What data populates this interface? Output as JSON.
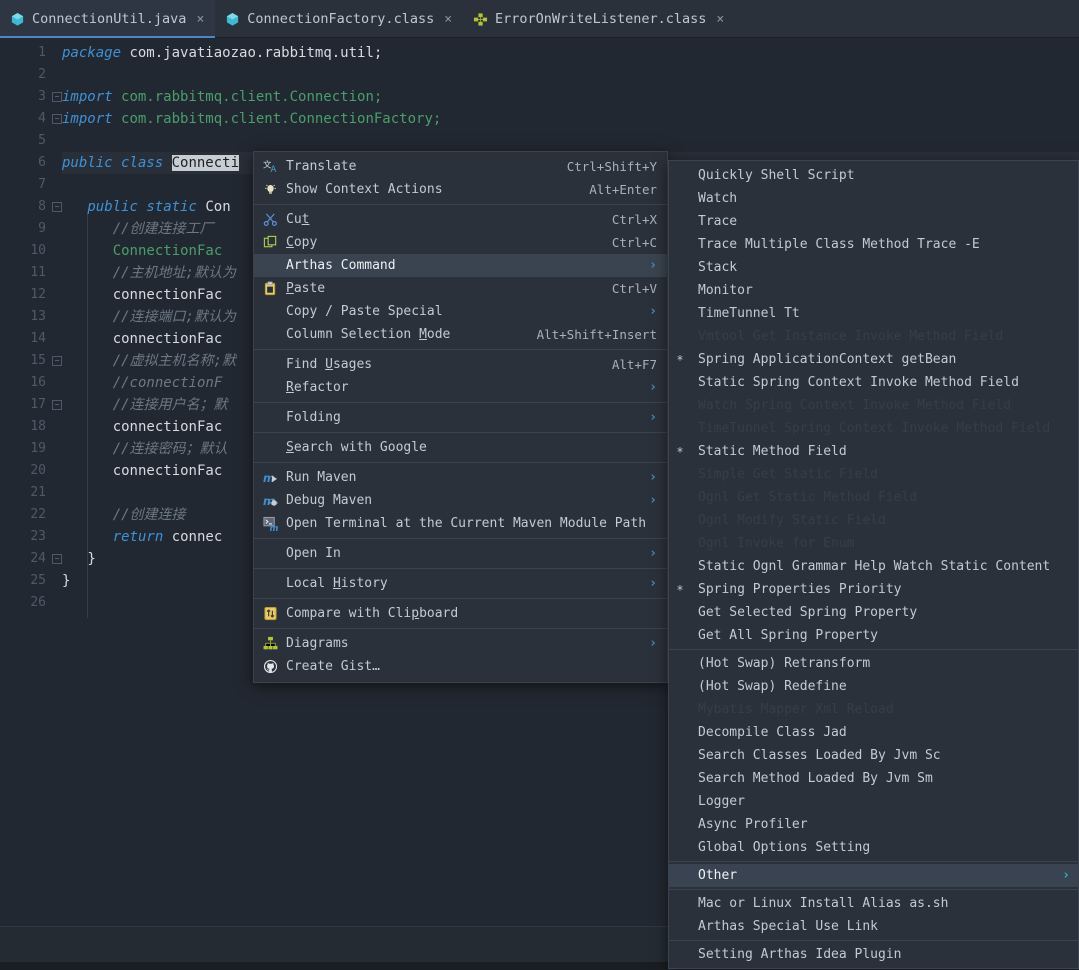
{
  "tabs": [
    {
      "label": "ConnectionUtil.java",
      "icon": "java-class-icon",
      "active": true,
      "close": "×"
    },
    {
      "label": "ConnectionFactory.class",
      "icon": "java-class-icon",
      "active": false,
      "close": "×"
    },
    {
      "label": "ErrorOnWriteListener.class",
      "icon": "java-interface-icon",
      "active": false,
      "close": "×"
    }
  ],
  "editor": {
    "file": "ConnectionUtil.java",
    "selection": "Connecti",
    "gutter": [
      "1",
      "2",
      "3",
      "4",
      "5",
      "6",
      "7",
      "8",
      "9",
      "10",
      "11",
      "12",
      "13",
      "14",
      "15",
      "16",
      "17",
      "18",
      "19",
      "20",
      "21",
      "22",
      "23",
      "24",
      "25",
      "26"
    ],
    "lines": [
      {
        "n": 1,
        "text": "package com.javatiaozao.rabbitmq.util;"
      },
      {
        "n": 2,
        "text": ""
      },
      {
        "n": 3,
        "text": "import com.rabbitmq.client.Connection;"
      },
      {
        "n": 4,
        "text": "import com.rabbitmq.client.ConnectionFactory;"
      },
      {
        "n": 5,
        "text": ""
      },
      {
        "n": 6,
        "text": "public class Connecti"
      },
      {
        "n": 7,
        "text": ""
      },
      {
        "n": 8,
        "text": "public static Con"
      },
      {
        "n": 9,
        "text": "//创建连接工厂"
      },
      {
        "n": 10,
        "text": "ConnectionFac"
      },
      {
        "n": 11,
        "text": "//主机地址;默认为"
      },
      {
        "n": 12,
        "text": "connectionFac"
      },
      {
        "n": 13,
        "text": "//连接端口;默认为"
      },
      {
        "n": 14,
        "text": "connectionFac"
      },
      {
        "n": 15,
        "text": "//虚拟主机名称;默"
      },
      {
        "n": 16,
        "text": "//connectionF"
      },
      {
        "n": 17,
        "text": "//连接用户名；默"
      },
      {
        "n": 18,
        "text": "connectionFac"
      },
      {
        "n": 19,
        "text": "//连接密码；默认"
      },
      {
        "n": 20,
        "text": "connectionFac"
      },
      {
        "n": 21,
        "text": ""
      },
      {
        "n": 22,
        "text": "//创建连接"
      },
      {
        "n": 23,
        "text": "return connec"
      },
      {
        "n": 24,
        "text": "}"
      },
      {
        "n": 25,
        "text": "}"
      },
      {
        "n": 26,
        "text": ""
      }
    ]
  },
  "context_menu": {
    "items": [
      {
        "label": "Translate",
        "shortcut": "Ctrl+Shift+Y",
        "icon": "translate-icon",
        "arrow": false,
        "highlight": false,
        "sep_after": false
      },
      {
        "label": "Show Context Actions",
        "shortcut": "Alt+Enter",
        "icon": "lightbulb-icon",
        "arrow": false,
        "highlight": false,
        "sep_after": true
      },
      {
        "label": "Cut",
        "shortcut": "Ctrl+X",
        "icon": "scissors-icon",
        "arrow": false,
        "highlight": false,
        "sep_after": false,
        "mnemonic": 2
      },
      {
        "label": "Copy",
        "shortcut": "Ctrl+C",
        "icon": "copy-icon",
        "arrow": false,
        "highlight": false,
        "sep_after": false,
        "mnemonic": 0
      },
      {
        "label": "Arthas Command",
        "shortcut": "",
        "icon": "",
        "arrow": true,
        "highlight": true,
        "sep_after": false
      },
      {
        "label": "Paste",
        "shortcut": "Ctrl+V",
        "icon": "paste-icon",
        "arrow": false,
        "highlight": false,
        "sep_after": false,
        "mnemonic": 0
      },
      {
        "label": "Copy / Paste Special",
        "shortcut": "",
        "icon": "",
        "arrow": true,
        "highlight": false,
        "sep_after": false
      },
      {
        "label": "Column Selection Mode",
        "shortcut": "Alt+Shift+Insert",
        "icon": "",
        "arrow": false,
        "highlight": false,
        "sep_after": true,
        "mnemonic": 17
      },
      {
        "label": "Find Usages",
        "shortcut": "Alt+F7",
        "icon": "",
        "arrow": false,
        "highlight": false,
        "sep_after": false,
        "mnemonic": 5
      },
      {
        "label": "Refactor",
        "shortcut": "",
        "icon": "",
        "arrow": true,
        "highlight": false,
        "sep_after": true,
        "mnemonic": 0
      },
      {
        "label": "Folding",
        "shortcut": "",
        "icon": "",
        "arrow": true,
        "highlight": false,
        "sep_after": true
      },
      {
        "label": "Search with Google",
        "shortcut": "",
        "icon": "",
        "arrow": false,
        "highlight": false,
        "sep_after": true,
        "mnemonic": 0
      },
      {
        "label": "Run Maven",
        "shortcut": "",
        "icon": "maven-run-icon",
        "arrow": true,
        "highlight": false,
        "sep_after": false
      },
      {
        "label": "Debug Maven",
        "shortcut": "",
        "icon": "maven-debug-icon",
        "arrow": true,
        "highlight": false,
        "sep_after": false
      },
      {
        "label": "Open Terminal at the Current Maven Module Path",
        "shortcut": "",
        "icon": "terminal-maven-icon",
        "arrow": false,
        "highlight": false,
        "sep_after": true
      },
      {
        "label": "Open In",
        "shortcut": "",
        "icon": "",
        "arrow": true,
        "highlight": false,
        "sep_after": true
      },
      {
        "label": "Local History",
        "shortcut": "",
        "icon": "",
        "arrow": true,
        "highlight": false,
        "sep_after": true,
        "mnemonic": 6
      },
      {
        "label": "Compare with Clipboard",
        "shortcut": "",
        "icon": "compare-icon",
        "arrow": false,
        "highlight": false,
        "sep_after": true,
        "mnemonic": 16
      },
      {
        "label": "Diagrams",
        "shortcut": "",
        "icon": "diagram-icon",
        "arrow": true,
        "highlight": false,
        "sep_after": false
      },
      {
        "label": "Create Gist…",
        "shortcut": "",
        "icon": "github-icon",
        "arrow": false,
        "highlight": false,
        "sep_after": false
      }
    ]
  },
  "submenu": {
    "title": "Arthas Command",
    "items": [
      {
        "label": "Quickly Shell Script",
        "star": false,
        "disabled": false,
        "arrow": false,
        "highlight": false,
        "sep_after": false
      },
      {
        "label": "Watch",
        "star": false,
        "disabled": false,
        "arrow": false,
        "highlight": false,
        "sep_after": false
      },
      {
        "label": "Trace",
        "star": false,
        "disabled": false,
        "arrow": false,
        "highlight": false,
        "sep_after": false
      },
      {
        "label": "Trace Multiple Class Method Trace -E",
        "star": false,
        "disabled": false,
        "arrow": false,
        "highlight": false,
        "sep_after": false
      },
      {
        "label": "Stack",
        "star": false,
        "disabled": false,
        "arrow": false,
        "highlight": false,
        "sep_after": false
      },
      {
        "label": "Monitor",
        "star": false,
        "disabled": false,
        "arrow": false,
        "highlight": false,
        "sep_after": false
      },
      {
        "label": "TimeTunnel Tt",
        "star": false,
        "disabled": false,
        "arrow": false,
        "highlight": false,
        "sep_after": false
      },
      {
        "label": "Vmtool Get Instance Invoke Method Field",
        "star": false,
        "disabled": true,
        "arrow": false,
        "highlight": false,
        "sep_after": false
      },
      {
        "label": "Spring ApplicationContext getBean",
        "star": true,
        "disabled": false,
        "arrow": false,
        "highlight": false,
        "sep_after": false
      },
      {
        "label": "Static Spring Context Invoke  Method Field",
        "star": false,
        "disabled": false,
        "arrow": false,
        "highlight": false,
        "sep_after": false
      },
      {
        "label": "Watch Spring Context Invoke Method Field",
        "star": false,
        "disabled": true,
        "arrow": false,
        "highlight": false,
        "sep_after": false
      },
      {
        "label": "TimeTunnel Spring Context Invoke Method Field",
        "star": false,
        "disabled": true,
        "arrow": false,
        "highlight": false,
        "sep_after": false
      },
      {
        "label": "Static Method Field",
        "star": true,
        "disabled": false,
        "arrow": false,
        "highlight": false,
        "sep_after": false
      },
      {
        "label": "Simple Get Static Field",
        "star": false,
        "disabled": true,
        "arrow": false,
        "highlight": false,
        "sep_after": false
      },
      {
        "label": "Ognl Get Static Method Field",
        "star": false,
        "disabled": true,
        "arrow": false,
        "highlight": false,
        "sep_after": false
      },
      {
        "label": "Ognl Modify Static Field",
        "star": false,
        "disabled": true,
        "arrow": false,
        "highlight": false,
        "sep_after": false
      },
      {
        "label": "Ognl Invoke for Enum",
        "star": false,
        "disabled": true,
        "arrow": false,
        "highlight": false,
        "sep_after": false
      },
      {
        "label": "Static Ognl Grammar Help Watch Static Content",
        "star": false,
        "disabled": false,
        "arrow": false,
        "highlight": false,
        "sep_after": false
      },
      {
        "label": "Spring Properties Priority",
        "star": true,
        "disabled": false,
        "arrow": false,
        "highlight": false,
        "sep_after": false
      },
      {
        "label": "Get Selected Spring Property",
        "star": false,
        "disabled": false,
        "arrow": false,
        "highlight": false,
        "sep_after": false
      },
      {
        "label": "Get All Spring Property",
        "star": false,
        "disabled": false,
        "arrow": false,
        "highlight": false,
        "sep_after": true
      },
      {
        "label": "(Hot Swap) Retransform",
        "star": false,
        "disabled": false,
        "arrow": false,
        "highlight": false,
        "sep_after": false
      },
      {
        "label": "(Hot Swap) Redefine",
        "star": false,
        "disabled": false,
        "arrow": false,
        "highlight": false,
        "sep_after": false
      },
      {
        "label": "Mybatis Mapper Xml Reload",
        "star": false,
        "disabled": true,
        "arrow": false,
        "highlight": false,
        "sep_after": false
      },
      {
        "label": "Decompile Class Jad",
        "star": false,
        "disabled": false,
        "arrow": false,
        "highlight": false,
        "sep_after": false
      },
      {
        "label": "Search Classes Loaded By Jvm Sc",
        "star": false,
        "disabled": false,
        "arrow": false,
        "highlight": false,
        "sep_after": false
      },
      {
        "label": "Search Method Loaded By Jvm Sm",
        "star": false,
        "disabled": false,
        "arrow": false,
        "highlight": false,
        "sep_after": false
      },
      {
        "label": "Logger",
        "star": false,
        "disabled": false,
        "arrow": false,
        "highlight": false,
        "sep_after": false
      },
      {
        "label": "Async Profiler",
        "star": false,
        "disabled": false,
        "arrow": false,
        "highlight": false,
        "sep_after": false
      },
      {
        "label": "Global Options Setting",
        "star": false,
        "disabled": false,
        "arrow": false,
        "highlight": false,
        "sep_after": true
      },
      {
        "label": "Other",
        "star": false,
        "disabled": false,
        "arrow": true,
        "highlight": true,
        "sep_after": true
      },
      {
        "label": "Mac or Linux Install Alias as.sh",
        "star": false,
        "disabled": false,
        "arrow": false,
        "highlight": false,
        "sep_after": false
      },
      {
        "label": "Arthas Special Use Link",
        "star": false,
        "disabled": false,
        "arrow": false,
        "highlight": false,
        "sep_after": true
      },
      {
        "label": "Setting Arthas Idea Plugin",
        "star": false,
        "disabled": false,
        "arrow": false,
        "highlight": false,
        "sep_after": false
      }
    ]
  },
  "colors": {
    "menu_bg": "#2b313a",
    "menu_highlight": "#3a4450",
    "editor_bg": "#222831",
    "accent": "#4a88c7",
    "arrow_teal": "#27b5c4"
  }
}
